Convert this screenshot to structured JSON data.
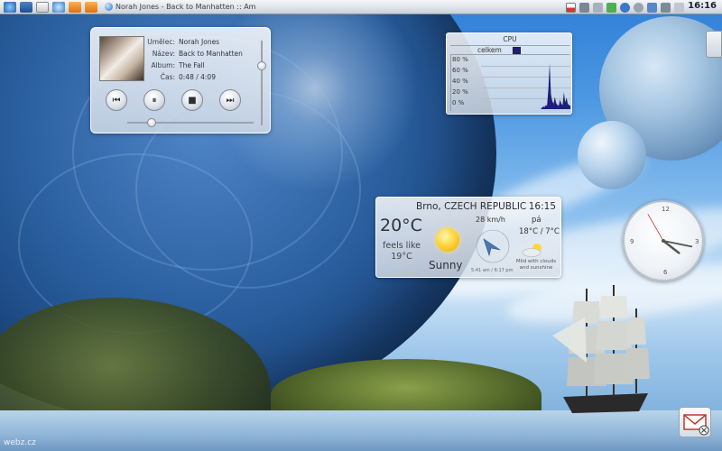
{
  "taskbar": {
    "window_title": "Norah Jones - Back to Manhatten  :: Am",
    "clock": "16:16"
  },
  "now_playing": {
    "artist_label": "Umělec:",
    "artist": "Norah Jones",
    "title_label": "Název:",
    "title": "Back to Manhatten",
    "album_label": "Album:",
    "album": "The Fall",
    "time_label": "Čas:",
    "time": "0:48 / 4:09",
    "progress": 0.19,
    "volume": 0.7
  },
  "cpu_monitor": {
    "title": "CPU",
    "legend": "celkem",
    "series_color": "#1f1f7a",
    "ticks": [
      "80 %",
      "60 %",
      "40 %",
      "20 %",
      "0 %"
    ]
  },
  "chart_data": {
    "type": "area",
    "title": "CPU",
    "series": [
      {
        "name": "celkem",
        "values": [
          0,
          0,
          0,
          0,
          0,
          0,
          0,
          0,
          0,
          0,
          0,
          0,
          0,
          0,
          0,
          0,
          0,
          0,
          0,
          0,
          0,
          0,
          0,
          0,
          0,
          0,
          0,
          0,
          0,
          0,
          0,
          0,
          0,
          0,
          0,
          0,
          0,
          0,
          0,
          0,
          0,
          0,
          0,
          0,
          0,
          0,
          0,
          2,
          4,
          3,
          6,
          5,
          30,
          68,
          22,
          12,
          8,
          18,
          9,
          6,
          5,
          14,
          8,
          6,
          25,
          10,
          17,
          8,
          6,
          5
        ]
      }
    ],
    "ylim": [
      0,
      80
    ]
  },
  "weather": {
    "location": "Brno, CZECH REPUBLIC",
    "time": "16:15",
    "temperature": "20°C",
    "feels_like": "feels like 19°C",
    "condition": "Sunny",
    "wind": "28 km/h",
    "sun_times": "5:41 am / 6:17 pm",
    "forecast_day": "pá",
    "forecast_temp": "18°C / 7°C",
    "forecast_desc": "Mild with clouds and sunshine"
  },
  "analog_clock": {
    "hours": 16,
    "minutes": 16,
    "seconds": 55
  },
  "watermark": "webz.cz"
}
